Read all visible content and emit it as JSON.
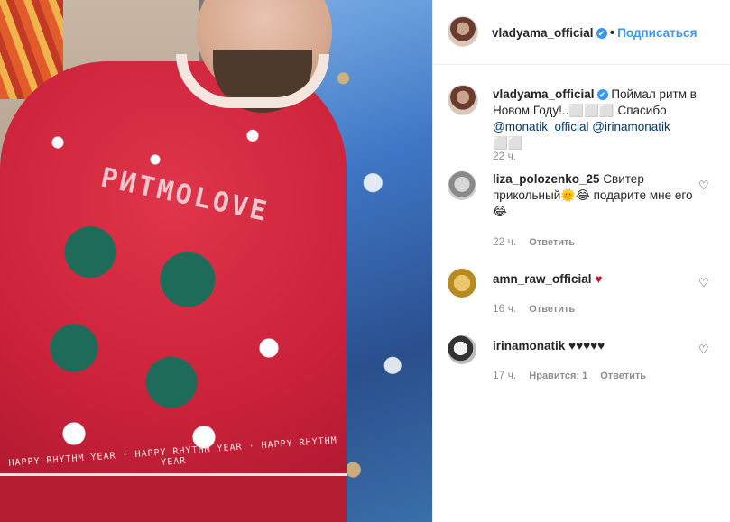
{
  "post_author": {
    "username": "vladyama_official",
    "verified_mark": "✔",
    "separator": "•",
    "follow_label": "Подписаться"
  },
  "caption": {
    "username": "vladyama_official",
    "verified_mark": "✔",
    "text": "Поймал ритм в Новом Году!..⬜⬜⬜ Спасибо",
    "mention1": "@monatik_official",
    "mention2": "@irinamonatik",
    "tail_emoji": "⬜⬜",
    "time": "22 ч."
  },
  "comments": [
    {
      "username": "liza_polozenko_25",
      "text_part1": "Свитер прикольный",
      "emoji1": "🌞😂",
      "text_part2": " подарите мне его",
      "emoji2": "😂",
      "time": "22 ч.",
      "reply_label": "Ответить"
    },
    {
      "username": "amn_raw_official",
      "heart": "♥",
      "time": "16 ч.",
      "reply_label": "Ответить"
    },
    {
      "username": "irinamonatik",
      "hearts": "♥♥♥♥♥",
      "time": "17 ч.",
      "likes_label": "Нравится: 1",
      "reply_label": "Ответить"
    }
  ],
  "media": {
    "sweater_text": "PИTMOLOVE",
    "hem_text": "HAPPY RHYTHM YEAR · HAPPY RHYTHM YEAR · HAPPY RHYTHM YEAR"
  },
  "icons": {
    "like_outline": "♡"
  },
  "colors": {
    "accent_blue": "#3897f0",
    "heart_red": "#c8102e",
    "muted_gray": "#8e8e8e",
    "sweater_red": "#c9213a"
  }
}
